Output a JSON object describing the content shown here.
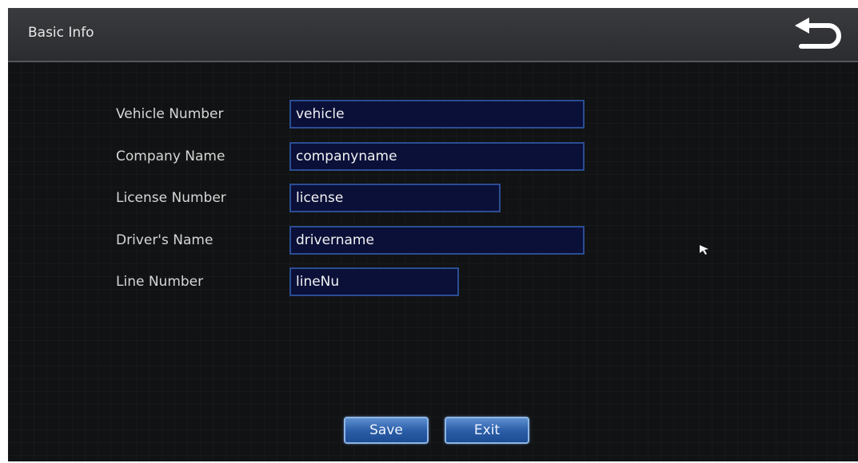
{
  "window": {
    "title": "Basic Info"
  },
  "header": {
    "back_icon": "return-arrow-icon"
  },
  "form": {
    "fields": [
      {
        "label": "Vehicle Number",
        "value": "vehicle"
      },
      {
        "label": "Company Name",
        "value": "companyname"
      },
      {
        "label": "License Number",
        "value": "license"
      },
      {
        "label": "Driver's Name",
        "value": "drivername"
      },
      {
        "label": "Line Number",
        "value": "lineNu"
      }
    ]
  },
  "buttons": {
    "save_label": "Save",
    "exit_label": "Exit"
  },
  "colors": {
    "background": "#111213",
    "title_bar": "#333437",
    "input_fill": "#0a1038",
    "input_border": "#2b4d93",
    "button_fill": "#2c5fa8",
    "text": "#d6d6d6"
  }
}
